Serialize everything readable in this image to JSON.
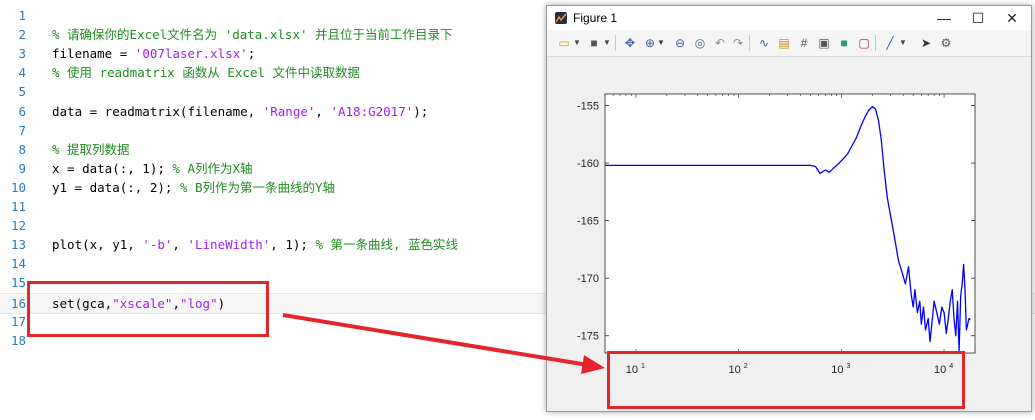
{
  "editor": {
    "lines": [
      {
        "n": "1",
        "parts": []
      },
      {
        "n": "2",
        "parts": [
          {
            "t": "% 请确保你的Excel文件名为 'data.xlsx' 并且位于当前工作目录下",
            "c": "cmt"
          }
        ]
      },
      {
        "n": "3",
        "parts": [
          {
            "t": "filename = ",
            "c": ""
          },
          {
            "t": "'007laser.xlsx'",
            "c": "str"
          },
          {
            "t": ";",
            "c": ""
          }
        ]
      },
      {
        "n": "4",
        "parts": [
          {
            "t": "% 使用 readmatrix 函数从 Excel 文件中读取数据",
            "c": "cmt"
          }
        ]
      },
      {
        "n": "5",
        "parts": []
      },
      {
        "n": "6",
        "parts": [
          {
            "t": "data = readmatrix(filename, ",
            "c": ""
          },
          {
            "t": "'Range'",
            "c": "str"
          },
          {
            "t": ", ",
            "c": ""
          },
          {
            "t": "'A18:G2017'",
            "c": "str"
          },
          {
            "t": ");",
            "c": ""
          }
        ]
      },
      {
        "n": "7",
        "parts": []
      },
      {
        "n": "8",
        "parts": [
          {
            "t": "% 提取列数据",
            "c": "cmt"
          }
        ]
      },
      {
        "n": "9",
        "parts": [
          {
            "t": "x = data(:, 1); ",
            "c": ""
          },
          {
            "t": "% A列作为X轴",
            "c": "cmt"
          }
        ]
      },
      {
        "n": "10",
        "parts": [
          {
            "t": "y1 = data(:, 2); ",
            "c": ""
          },
          {
            "t": "% B列作为第一条曲线的Y轴",
            "c": "cmt"
          }
        ]
      },
      {
        "n": "11",
        "parts": []
      },
      {
        "n": "12",
        "parts": []
      },
      {
        "n": "13",
        "parts": [
          {
            "t": "plot(x, y1, ",
            "c": ""
          },
          {
            "t": "'-b'",
            "c": "str"
          },
          {
            "t": ", ",
            "c": ""
          },
          {
            "t": "'LineWidth'",
            "c": "str"
          },
          {
            "t": ", 1); ",
            "c": ""
          },
          {
            "t": "% 第一条曲线, 蓝色实线",
            "c": "cmt"
          }
        ]
      },
      {
        "n": "14",
        "parts": []
      },
      {
        "n": "15",
        "parts": []
      },
      {
        "n": "16",
        "parts": [
          {
            "t": "set(gca,",
            "c": ""
          },
          {
            "t": "\"xscale\"",
            "c": "str"
          },
          {
            "t": ",",
            "c": ""
          },
          {
            "t": "\"log\"",
            "c": "str"
          },
          {
            "t": ")",
            "c": ""
          }
        ]
      },
      {
        "n": "17",
        "parts": []
      },
      {
        "n": "18",
        "parts": []
      }
    ]
  },
  "figure": {
    "title": "Figure 1",
    "window_buttons": {
      "minimize": "—",
      "maximize": "☐",
      "close": "✕"
    }
  },
  "chart_data": {
    "type": "line",
    "x_scale": "log",
    "xlim": [
      5,
      20000
    ],
    "ylim": [
      -176.5,
      -154
    ],
    "x_ticks": [
      10,
      100,
      1000,
      10000
    ],
    "x_tick_labels": [
      "10",
      "10",
      "10",
      "10"
    ],
    "x_tick_exponents": [
      "1",
      "2",
      "3",
      "4"
    ],
    "y_ticks": [
      -175,
      -170,
      -165,
      -160,
      -155
    ],
    "y_tick_labels": [
      "-175",
      "-170",
      "-165",
      "-160",
      "-155"
    ],
    "series": [
      {
        "color": "#0000ff",
        "x": [
          5,
          10,
          50,
          100,
          300,
          500,
          560,
          620,
          700,
          760,
          850,
          950,
          1050,
          1150,
          1250,
          1400,
          1550,
          1700,
          1850,
          2000,
          2150,
          2300,
          2450,
          2600,
          2800,
          3000,
          3300,
          3600,
          3900,
          4200,
          4500,
          4800,
          5000,
          5200,
          5500,
          5800,
          6000,
          6300,
          6600,
          7000,
          7300,
          7600,
          8000,
          8500,
          9000,
          9500,
          10000,
          10500,
          11000,
          11500,
          12000,
          12500,
          13000,
          13500,
          14000,
          14500,
          15000,
          15500,
          16000,
          16500,
          17000,
          17500,
          18000
        ],
        "y": [
          -160.2,
          -160.2,
          -160.2,
          -160.2,
          -160.2,
          -160.2,
          -160.3,
          -160.9,
          -160.6,
          -160.8,
          -160.4,
          -160.0,
          -159.6,
          -159.2,
          -158.6,
          -157.8,
          -156.8,
          -156.0,
          -155.4,
          -155.1,
          -155.3,
          -156.3,
          -158.0,
          -160.5,
          -163.0,
          -164.5,
          -166.5,
          -168.5,
          -169.5,
          -170.5,
          -169.0,
          -171.5,
          -172.5,
          -171.0,
          -173.0,
          -172.0,
          -174.0,
          -172.5,
          -174.5,
          -173.5,
          -175.5,
          -174.0,
          -172.0,
          -173.0,
          -174.0,
          -172.5,
          -173.0,
          -174.8,
          -173.5,
          -172.0,
          -171.0,
          -173.5,
          -175.0,
          -172.0,
          -176.3,
          -171.5,
          -170.5,
          -168.8,
          -171.0,
          -174.5,
          -174.0,
          -173.5,
          -173.6
        ]
      }
    ]
  },
  "annotation": {
    "color": "#e3262b"
  }
}
